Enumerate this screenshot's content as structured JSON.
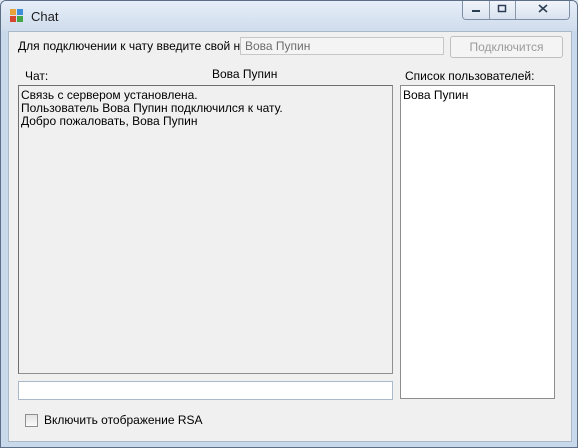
{
  "window": {
    "title": "Chat",
    "icon": "chat-app-icon",
    "buttons": [
      "minimize-icon",
      "restore-icon",
      "close-icon"
    ]
  },
  "connect": {
    "prompt_label": "Для подключении к чату введите свой ник:",
    "nick_value": "Вова Пупин",
    "button_label": "Подключится"
  },
  "chat": {
    "label": "Чат:",
    "current_user": "Вова Пупин",
    "messages": [
      "Связь с сервером установлена.",
      "Пользователь Вова Пупин подключился к чату.",
      "Добро пожаловать, Вова Пупин"
    ]
  },
  "users": {
    "label": "Список пользователей:",
    "items": [
      "Вова Пупин"
    ]
  },
  "message_input": {
    "value": ""
  },
  "rsa": {
    "label": "Включить отображение RSA",
    "checked": false
  }
}
